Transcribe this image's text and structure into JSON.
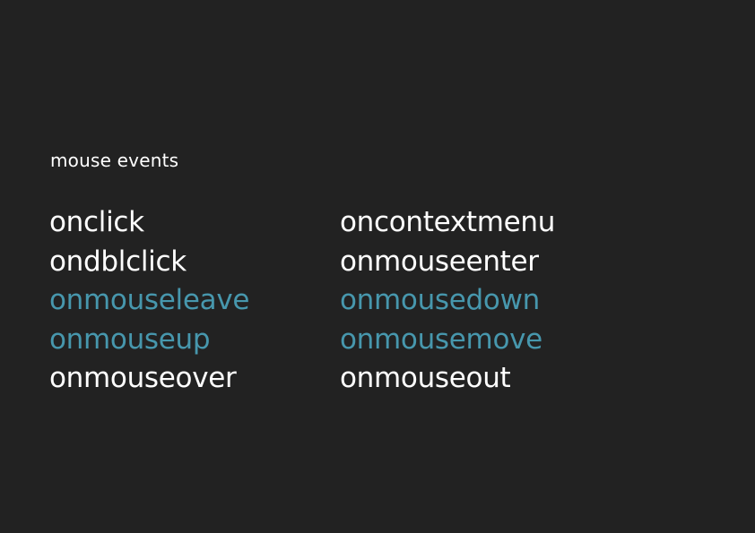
{
  "heading": "mouse events",
  "colors": {
    "background": "#222222",
    "text": "#ffffff",
    "highlight": "#4797ad"
  },
  "left_column": [
    {
      "label": "onclick",
      "highlighted": false
    },
    {
      "label": "ondblclick",
      "highlighted": false
    },
    {
      "label": "onmouseleave",
      "highlighted": true
    },
    {
      "label": "onmouseup",
      "highlighted": true
    },
    {
      "label": "onmouseover",
      "highlighted": false
    }
  ],
  "right_column": [
    {
      "label": "oncontextmenu",
      "highlighted": false
    },
    {
      "label": "onmouseenter",
      "highlighted": false
    },
    {
      "label": "onmousedown",
      "highlighted": true
    },
    {
      "label": "onmousemove",
      "highlighted": true
    },
    {
      "label": "onmouseout",
      "highlighted": false
    }
  ]
}
